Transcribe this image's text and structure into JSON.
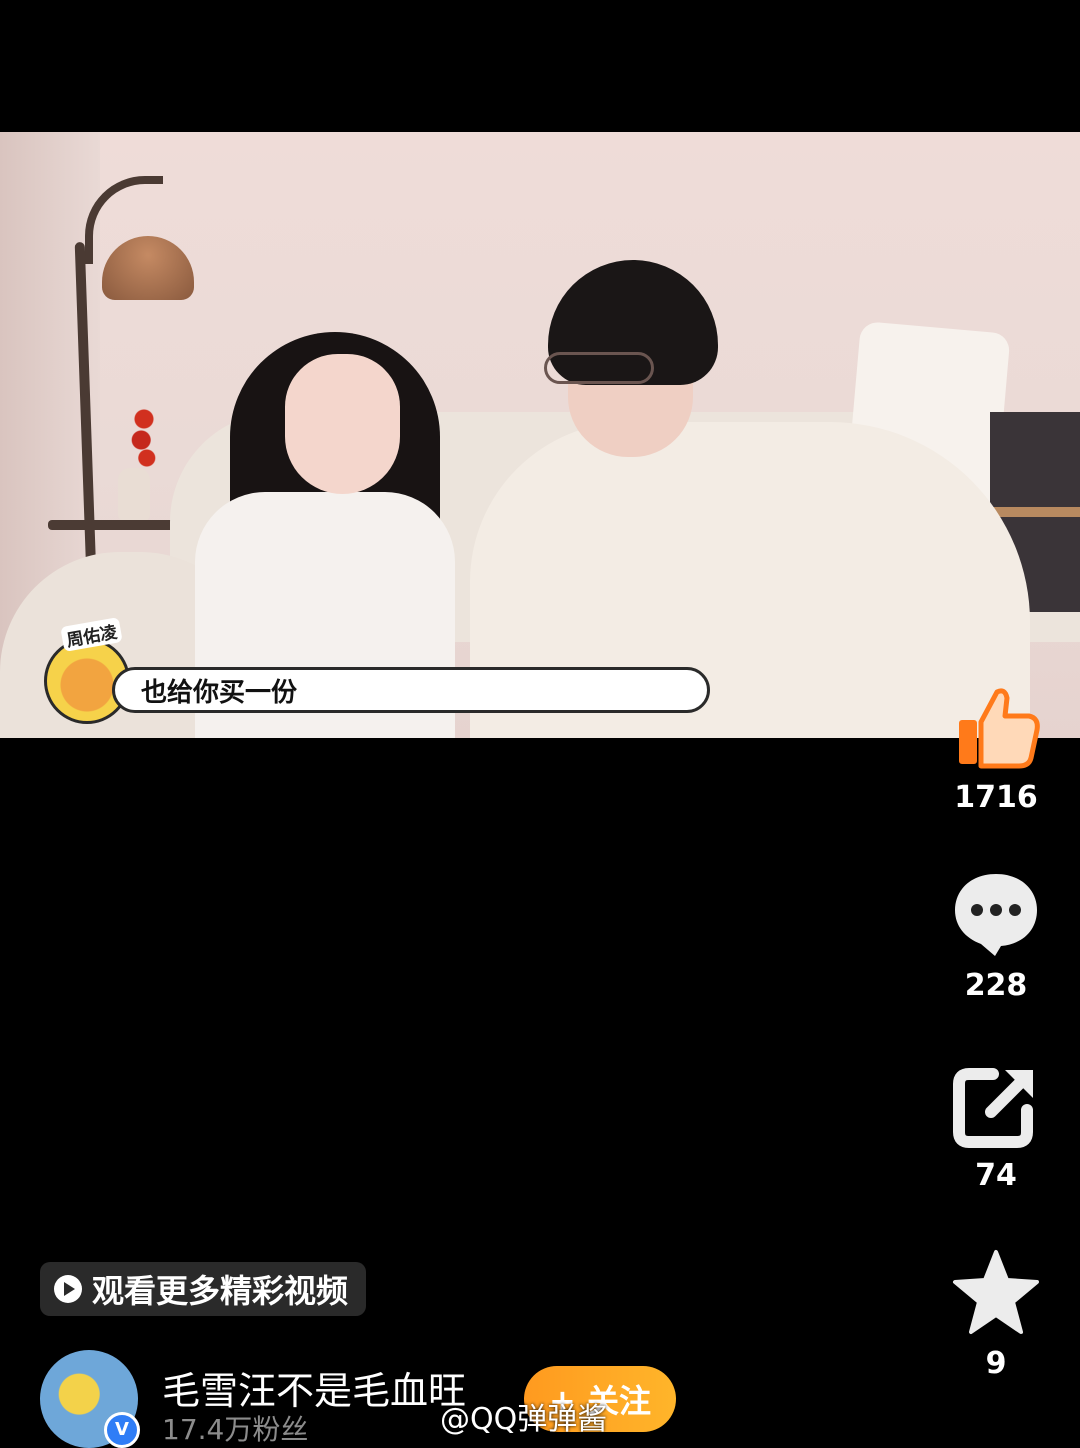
{
  "caption": {
    "speaker": "周佑凌",
    "text": "也给你买一份"
  },
  "actions": {
    "like_count": "1716",
    "comment_count": "228",
    "share_count": "74",
    "favorite_count": "9"
  },
  "more_videos_label": "观看更多精彩视频",
  "author": {
    "name": "毛雪汪不是毛血旺",
    "fans": "17.4万粉丝",
    "verified_mark": "V",
    "follow_label": "+ 关注"
  },
  "watermark": "@QQ弹弹酱",
  "colors": {
    "like": "#ff7a1a",
    "follow": "#ffa826",
    "verified": "#2f7df6"
  }
}
